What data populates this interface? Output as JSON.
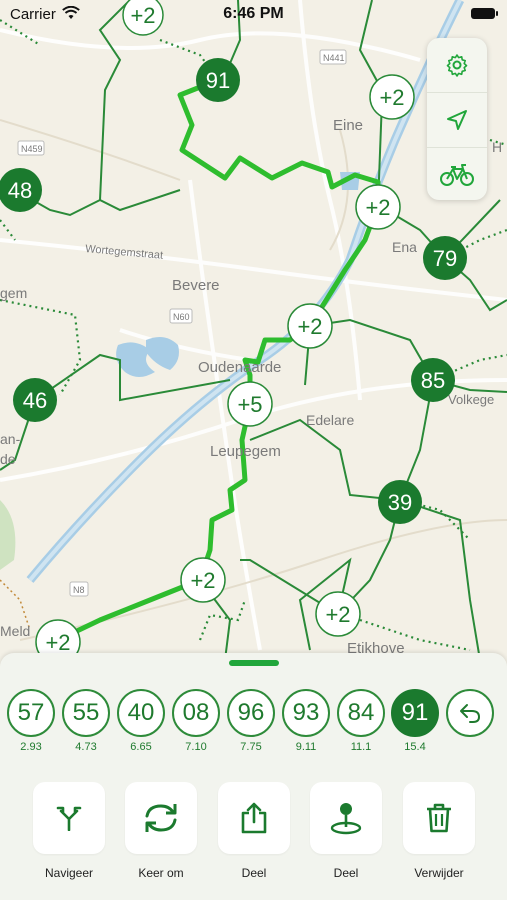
{
  "status_bar": {
    "carrier": "Carrier",
    "time": "6:46 PM"
  },
  "map": {
    "place_labels": [
      "Eine",
      "Bevere",
      "Oudenaarde",
      "Edelare",
      "Leupegem",
      "Etikhove",
      "Wortegemstraat",
      "Ena",
      "gem",
      "Volkege",
      "Meld",
      "an-",
      "de",
      "H"
    ],
    "road_labels": [
      "N441",
      "N459",
      "N60",
      "N8"
    ],
    "nodes": [
      "+2",
      "91",
      "+2",
      "+2",
      "48",
      "79",
      "+2",
      "46",
      "85",
      "+5",
      "39",
      "+2",
      "+2",
      "+2"
    ]
  },
  "map_controls": [
    {
      "icon": "gear-icon"
    },
    {
      "icon": "location-arrow-icon"
    },
    {
      "icon": "bicycle-icon"
    }
  ],
  "route": {
    "nodes": [
      {
        "number": "57",
        "distance": "2.93"
      },
      {
        "number": "55",
        "distance": "4.73"
      },
      {
        "number": "40",
        "distance": "6.65"
      },
      {
        "number": "08",
        "distance": "7.10"
      },
      {
        "number": "96",
        "distance": "7.75"
      },
      {
        "number": "93",
        "distance": "9.11"
      },
      {
        "number": "84",
        "distance": "11.1"
      },
      {
        "number": "91",
        "distance": "15.4"
      }
    ],
    "undo_icon": "undo-arrow-icon"
  },
  "actions": [
    {
      "label": "Navigeer",
      "icon": "navigate-fork-icon"
    },
    {
      "label": "Keer om",
      "icon": "reverse-arrows-icon"
    },
    {
      "label": "Deel",
      "icon": "share-icon"
    },
    {
      "label": "Deel",
      "icon": "map-pin-share-icon"
    },
    {
      "label": "Verwijder",
      "icon": "trash-icon"
    }
  ],
  "colors": {
    "accent": "#21a63b",
    "route_line": "#2ebd2e",
    "network": "#1f7a2e",
    "map_bg": "#f3f0e6"
  }
}
